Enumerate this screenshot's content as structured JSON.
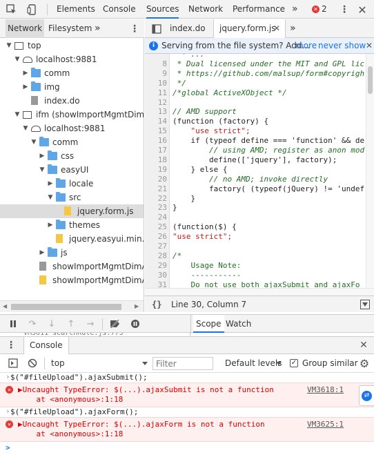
{
  "topbar": {
    "tabs": [
      "Elements",
      "Console",
      "Sources",
      "Network",
      "Performance"
    ],
    "active": "Sources",
    "more": "»",
    "error_count": "2"
  },
  "navigator": {
    "tabs": [
      "Network",
      "Filesystem"
    ],
    "more": "»",
    "tree": [
      {
        "label": "top",
        "depth": 0,
        "icon": "frame",
        "open": true
      },
      {
        "label": "localhost:9881",
        "depth": 1,
        "icon": "cloud",
        "open": true
      },
      {
        "label": "comm",
        "depth": 2,
        "icon": "folder",
        "open": false
      },
      {
        "label": "img",
        "depth": 2,
        "icon": "folder",
        "open": false
      },
      {
        "label": "index.do",
        "depth": 2,
        "icon": "file-gray",
        "open": null
      },
      {
        "label": "ifm (showImportMgmtDimAtt",
        "depth": 1,
        "icon": "frame",
        "open": true
      },
      {
        "label": "localhost:9881",
        "depth": 2,
        "icon": "cloud",
        "open": true
      },
      {
        "label": "comm",
        "depth": 3,
        "icon": "folder",
        "open": true
      },
      {
        "label": "css",
        "depth": 4,
        "icon": "folder",
        "open": false
      },
      {
        "label": "easyUI",
        "depth": 4,
        "icon": "folder",
        "open": true
      },
      {
        "label": "locale",
        "depth": 5,
        "icon": "folder",
        "open": false
      },
      {
        "label": "src",
        "depth": 5,
        "icon": "folder",
        "open": true
      },
      {
        "label": "jquery.form.js",
        "depth": 6,
        "icon": "file-yellow",
        "open": null,
        "selected": true
      },
      {
        "label": "themes",
        "depth": 5,
        "icon": "folder",
        "open": false
      },
      {
        "label": "jquery.easyui.min.js",
        "depth": 5,
        "icon": "file-yellow",
        "open": null
      },
      {
        "label": "js",
        "depth": 4,
        "icon": "folder",
        "open": false
      },
      {
        "label": "showImportMgmtDimAtt",
        "depth": 3,
        "icon": "file-gray",
        "open": null
      },
      {
        "label": "showImportMgmtDimAtt",
        "depth": 3,
        "icon": "file-yellow",
        "open": null
      }
    ]
  },
  "editor": {
    "tabs": [
      "index.do",
      "jquery.form.js"
    ],
    "active": "jquery.form.js",
    "more": "»",
    "info": {
      "text": "Serving from the file system? Add...",
      "more": "more",
      "never": "never show"
    },
    "lines": [
      {
        "n": "",
        "t": "  * ..."
      },
      {
        "n": "8",
        "t": " * Dual licensed under the MIT and GPL lic"
      },
      {
        "n": "9",
        "t": " * https://github.com/malsup/form#copyrigh"
      },
      {
        "n": "10",
        "t": " */"
      },
      {
        "n": "11",
        "t": "/*global ActiveXObject */"
      },
      {
        "n": "12",
        "t": ""
      },
      {
        "n": "13",
        "t": "// AMD support"
      },
      {
        "n": "14",
        "t": "(function (factory) {"
      },
      {
        "n": "15",
        "t": "    \"use strict\";"
      },
      {
        "n": "16",
        "t": "    if (typeof define === 'function' && de"
      },
      {
        "n": "17",
        "t": "        // using AMD; register as anon mod"
      },
      {
        "n": "18",
        "t": "        define(['jquery'], factory);"
      },
      {
        "n": "19",
        "t": "    } else {"
      },
      {
        "n": "20",
        "t": "        // no AMD; invoke directly"
      },
      {
        "n": "21",
        "t": "        factory( (typeof(jQuery) != 'undef"
      },
      {
        "n": "22",
        "t": "    }"
      },
      {
        "n": "23",
        "t": "}"
      },
      {
        "n": "24",
        "t": ""
      },
      {
        "n": "25",
        "t": "(function($) {"
      },
      {
        "n": "26",
        "t": "\"use strict\";"
      },
      {
        "n": "27",
        "t": ""
      },
      {
        "n": "28",
        "t": "/*"
      },
      {
        "n": "29",
        "t": "    Usage Note:"
      },
      {
        "n": "30",
        "t": "    -----------"
      },
      {
        "n": "31",
        "t": "    Do not use both ajaxSubmit and ajaxFo"
      }
    ],
    "status": {
      "braces": "{}",
      "position": "Line 30, Column 7"
    }
  },
  "debugger": {
    "tabs": [
      "Scope",
      "Watch"
    ],
    "active": "Scope",
    "peek": "VM3611 searchRule.js:773"
  },
  "console": {
    "title": "Console",
    "context": "top",
    "filter_placeholder": "Filter",
    "levels": "Default levels",
    "group_similar": "Group similar",
    "messages": [
      {
        "kind": "input",
        "text": "$(\"#fileUpload\").ajaxSubmit();"
      },
      {
        "kind": "error",
        "line1": "▶Uncaught TypeError: $(...).ajaxSubmit is not a function",
        "line2": "    at <anonymous>:1:18",
        "src": "VM3618:1"
      },
      {
        "kind": "input",
        "text": "$(\"#fileUpload\").ajaxForm();"
      },
      {
        "kind": "error",
        "line1": "▶Uncaught TypeError: $(...).ajaxForm is not a function",
        "line2": "    at <anonymous>:1:18",
        "src": "VM3625:1"
      }
    ],
    "prompt": ">"
  },
  "colors": {
    "accent": "#1a73e8",
    "error": "#d00000",
    "folder": "#5fa6e6",
    "js_file": "#f4c842"
  }
}
